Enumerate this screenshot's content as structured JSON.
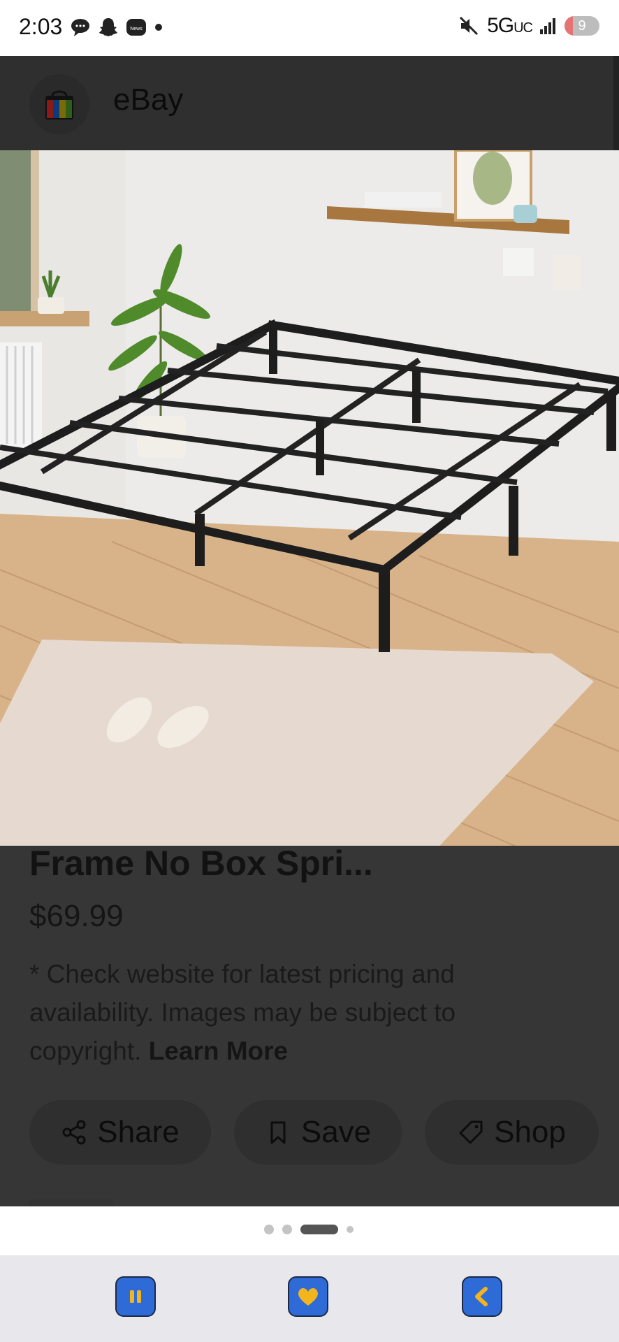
{
  "status_bar": {
    "time": "2:03",
    "network": "5G",
    "network_suffix": "UC",
    "battery": "9"
  },
  "app": {
    "name": "eBay"
  },
  "product": {
    "title": "Frame No Box Spri...",
    "price": "$69.99",
    "disclaimer": "* Check website for latest pricing and availability. Images may be subject to copyright.",
    "learn_more": "Learn More"
  },
  "actions": {
    "share": "Share",
    "save": "Save",
    "shop": "Shop"
  },
  "pager": {
    "count": 4,
    "active": 3
  },
  "icons": {
    "status": [
      "chat-bubble-icon",
      "snapchat-icon",
      "news-icon",
      "dot-icon",
      "mute-icon",
      "signal-icon",
      "battery-icon"
    ],
    "nav": [
      "pause-icon",
      "heart-icon",
      "back-arrow-icon"
    ]
  },
  "colors": {
    "overlay": "#363636",
    "nav_bar": "#e8e8ec",
    "nav_icon_blue": "#2f6bd6",
    "nav_icon_gold": "#f2b51d"
  }
}
